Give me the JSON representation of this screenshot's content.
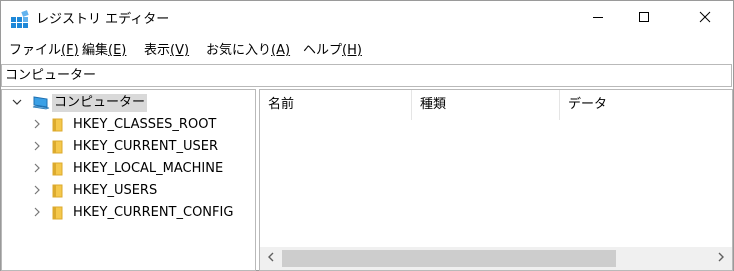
{
  "window": {
    "title": "レジストリ エディター",
    "controls": {
      "minimize": "minimize-icon",
      "maximize": "maximize-icon",
      "close": "close-icon"
    }
  },
  "menu": {
    "items": [
      {
        "label": "ファイル",
        "accel": "(F)"
      },
      {
        "label": "編集",
        "accel": "(E)"
      },
      {
        "label": "表示",
        "accel": "(V)"
      },
      {
        "label": "お気に入り",
        "accel": "(A)"
      },
      {
        "label": "ヘルプ",
        "accel": "(H)"
      }
    ]
  },
  "address": {
    "value": "コンピューター"
  },
  "tree": {
    "root": {
      "label": "コンピューター",
      "icon": "computer-icon",
      "expanded": true,
      "selected": true
    },
    "children": [
      {
        "label": "HKEY_CLASSES_ROOT",
        "icon": "folder-icon"
      },
      {
        "label": "HKEY_CURRENT_USER",
        "icon": "folder-icon"
      },
      {
        "label": "HKEY_LOCAL_MACHINE",
        "icon": "folder-icon"
      },
      {
        "label": "HKEY_USERS",
        "icon": "folder-icon"
      },
      {
        "label": "HKEY_CURRENT_CONFIG",
        "icon": "folder-icon"
      }
    ]
  },
  "list": {
    "columns": [
      {
        "label": "名前"
      },
      {
        "label": "種類"
      },
      {
        "label": "データ"
      }
    ],
    "rows": []
  },
  "colors": {
    "folder": "#f5c84c",
    "folder_dark": "#dcaa2d",
    "selection": "#d9d9d9",
    "icon_blue": "#1e88d8",
    "scroll_bg": "#f0f0f0",
    "scroll_thumb": "#cdcdcd"
  }
}
